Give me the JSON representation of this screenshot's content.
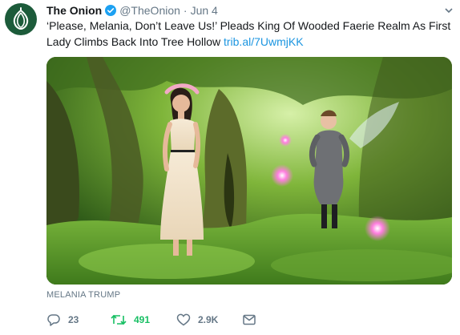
{
  "tweet": {
    "display_name": "The Onion",
    "verified": true,
    "handle": "@TheOnion",
    "separator": "·",
    "date": "Jun 4",
    "text": "‘Please, Melania, Don’t Leave Us!’ Pleads King Of Wooded Faerie Realm As First Lady Climbs Back Into Tree Hollow",
    "link": "trib.al/7UwmjKK",
    "media_caption": "MELANIA TRUMP"
  },
  "actions": {
    "reply_icon": "reply-icon",
    "reply_count": "23",
    "retweet_icon": "retweet-icon",
    "retweet_count": "491",
    "like_icon": "heart-icon",
    "like_count": "2.9K",
    "dm_icon": "envelope-icon"
  },
  "colors": {
    "avatar_bg": "#1c5b3a",
    "link": "#1b95e0",
    "retweet_active": "#17bf63",
    "muted": "#657786",
    "verified": "#1da1f2"
  }
}
